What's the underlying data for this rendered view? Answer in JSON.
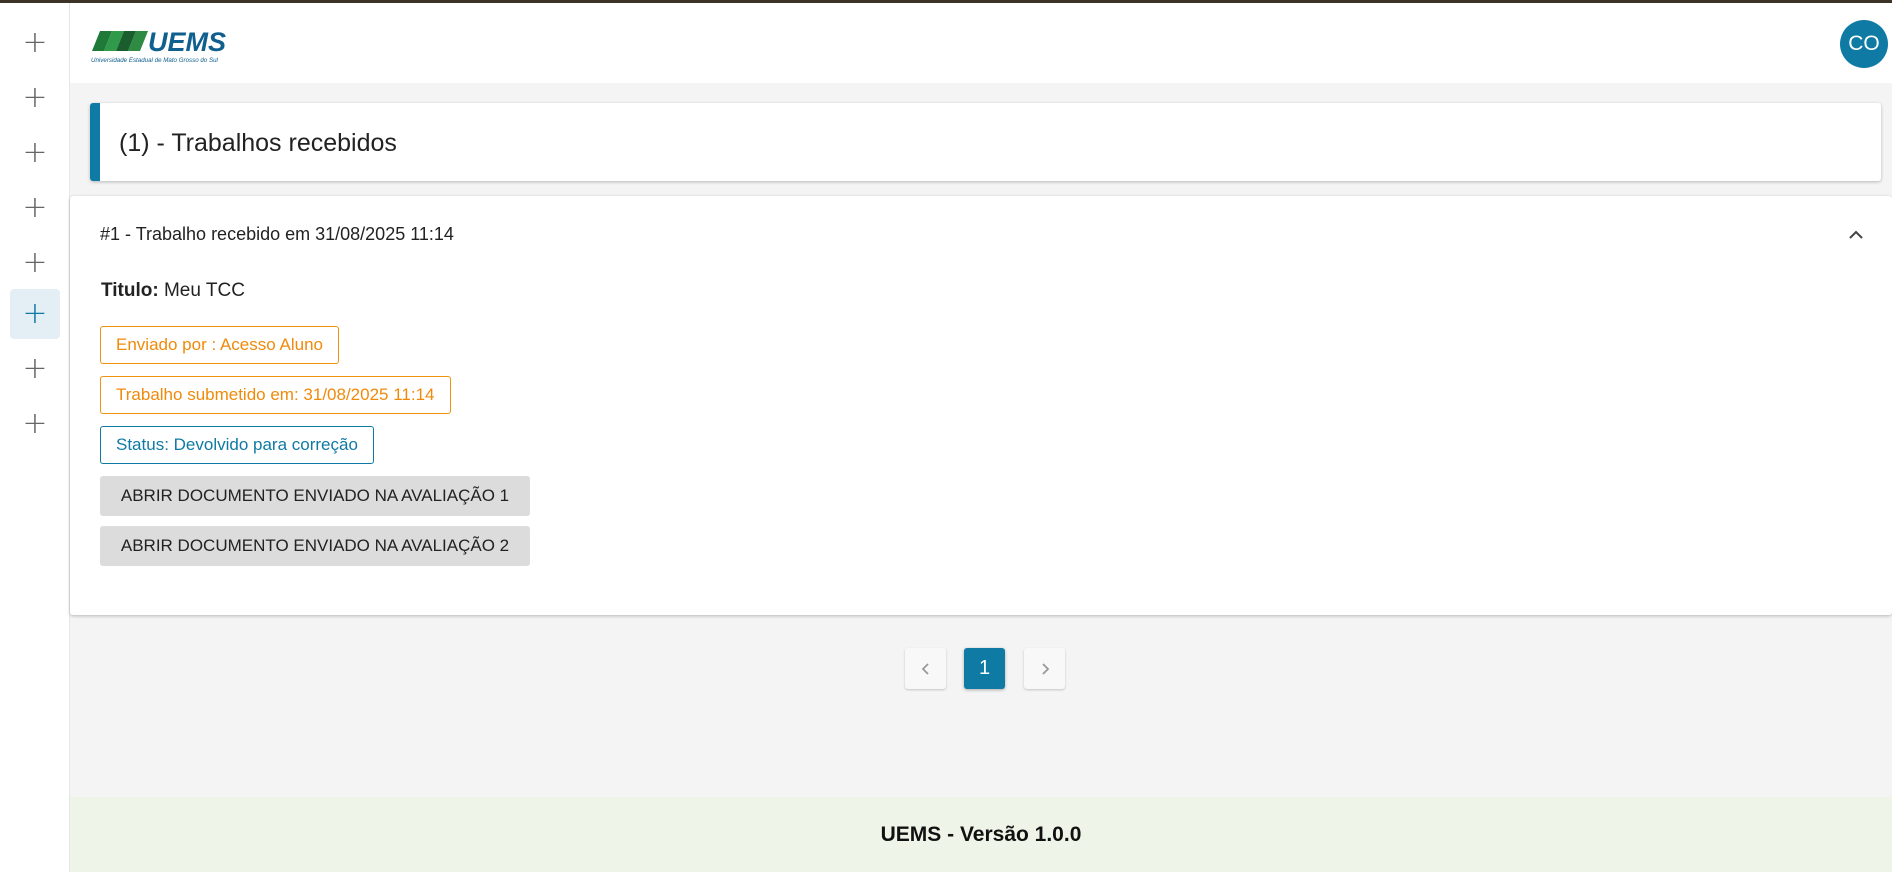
{
  "sidebar": {
    "items": [
      {
        "icon": "plus-icon",
        "active": false
      },
      {
        "icon": "plus-icon",
        "active": false
      },
      {
        "icon": "plus-icon",
        "active": false
      },
      {
        "icon": "plus-icon",
        "active": false
      },
      {
        "icon": "plus-icon",
        "active": false
      },
      {
        "icon": "plus-icon",
        "active": true
      },
      {
        "icon": "plus-icon",
        "active": false
      },
      {
        "icon": "plus-icon",
        "active": false
      }
    ]
  },
  "header": {
    "logo_text": "UEMS",
    "logo_subtitle": "Universidade Estadual de Mato Grosso do Sul",
    "avatar_initials": "CO"
  },
  "page": {
    "title": "(1) - Trabalhos recebidos"
  },
  "submission": {
    "header": "#1 - Trabalho recebido em 31/08/2025 11:14",
    "titulo_label": "Titulo:",
    "titulo_value": "Meu TCC",
    "sent_by": "Enviado por : Acesso Aluno",
    "submitted_at": "Trabalho submetido em: 31/08/2025 11:14",
    "status": "Status: Devolvido para correção",
    "doc_button_1": "ABRIR DOCUMENTO ENVIADO NA AVALIAÇÃO 1",
    "doc_button_2": "ABRIR DOCUMENTO ENVIADO NA AVALIAÇÃO 2"
  },
  "pagination": {
    "current_page": "1"
  },
  "footer": {
    "text": "UEMS - Versão 1.0.0"
  },
  "colors": {
    "primary": "#0f7aa3",
    "warning": "#ef8a0b",
    "footer_bg": "#eef5e8"
  }
}
